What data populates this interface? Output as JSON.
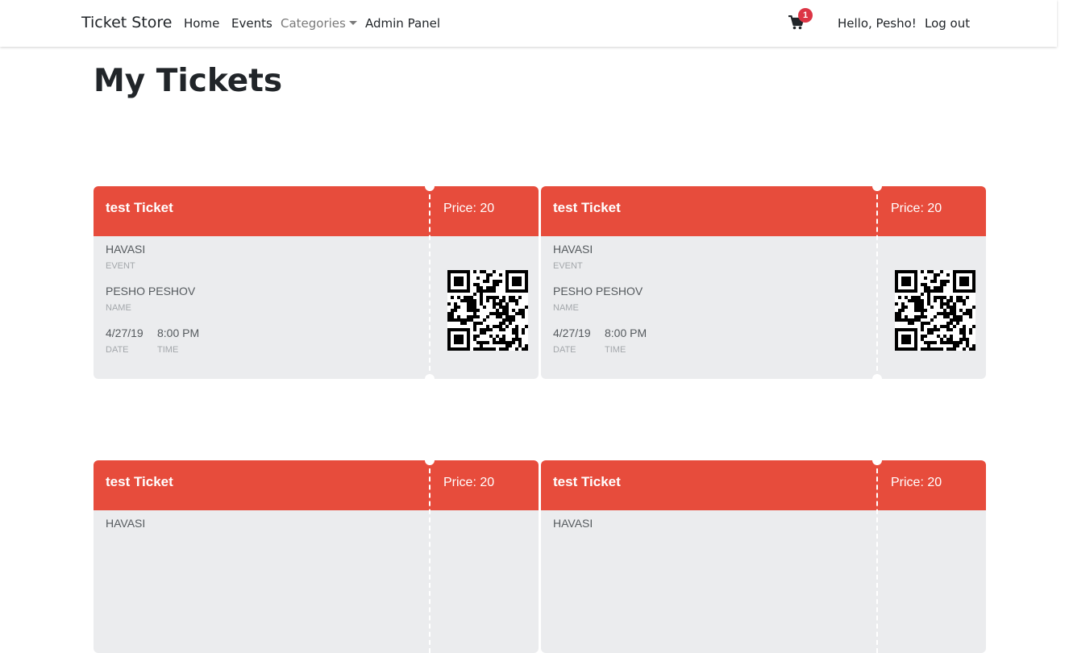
{
  "navbar": {
    "brand": "Ticket Store",
    "links": [
      "Home",
      "Events",
      "Categories",
      "Admin Panel"
    ],
    "cart_count": "1",
    "greeting": "Hello, Pesho!",
    "logout": "Log out",
    "cart_icon": "shopping-cart-icon"
  },
  "page": {
    "title": "My Tickets"
  },
  "colors": {
    "ticket_header": "#e74c3c",
    "ticket_body": "#ebecee",
    "badge": "#dc3545"
  },
  "ticket_labels": {
    "event": "EVENT",
    "name": "NAME",
    "date": "DATE",
    "time": "TIME"
  },
  "tickets": [
    {
      "title": "test Ticket",
      "price": "Price: 20",
      "event": "HAVASI",
      "name": "PESHO PESHOV",
      "date": "4/27/19",
      "time": "8:00 PM"
    },
    {
      "title": "test Ticket",
      "price": "Price: 20",
      "event": "HAVASI",
      "name": "PESHO PESHOV",
      "date": "4/27/19",
      "time": "8:00 PM"
    },
    {
      "title": "test Ticket",
      "price": "Price: 20",
      "event": "HAVASI"
    },
    {
      "title": "test Ticket",
      "price": "Price: 20",
      "event": "HAVASI"
    }
  ]
}
